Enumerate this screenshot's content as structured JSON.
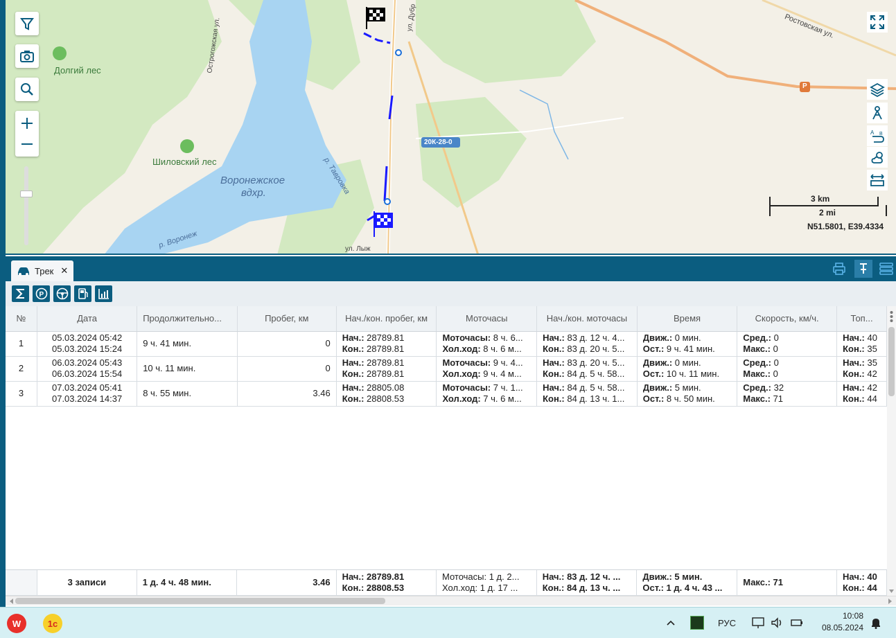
{
  "map": {
    "labels": {
      "dolgiy_les": "Долгий лес",
      "shilovskiy_les": "Шиловский лес",
      "reservoir_1": "Воронежское",
      "reservoir_2": "вдхр.",
      "river_tavrovka": "р. Тавровка",
      "river_voronezh": "р. Воронеж",
      "street_ostrogozhskaya": "Острогожская ул.",
      "street_dubr": "ул. Дубр",
      "street_rostovskaya": "Ростовская ул.",
      "street_lyzh": "ул. Лыж",
      "road_badge": "20К-28-0",
      "road_badge_small": "Р"
    },
    "scale_km": "3 km",
    "scale_mi": "2 mi",
    "coordinates": "N51.5801, E39.4334",
    "icons": {
      "filter": "filter-icon",
      "camera": "camera-icon",
      "search": "search-icon",
      "zoom_in": "plus-icon",
      "zoom_out": "minus-icon",
      "fullscreen": "fullscreen-icon",
      "layers": "layers-icon",
      "routing": "route-icon",
      "translate": "directions-icon",
      "weather": "weather-icon",
      "ruler": "ruler-icon"
    },
    "zoom_level": 0.65
  },
  "panel": {
    "tab_label": "Трек",
    "tab_close": "✕",
    "toolbar": [
      "sum-icon",
      "parking-icon",
      "steering-wheel-icon",
      "fuel-icon",
      "chart-icon"
    ]
  },
  "table": {
    "columns": [
      "№",
      "Дата",
      "Продолжительно...",
      "Пробег, км",
      "Нач./кон. пробег, км",
      "Моточасы",
      "Нач./кон. моточасы",
      "Время",
      "Скорость, км/ч.",
      "Топ..."
    ],
    "rows": [
      {
        "num": "1",
        "date_start": "05.03.2024 05:42",
        "date_end": "05.03.2024 15:24",
        "duration": "9 ч. 41 мин.",
        "mileage": "0",
        "odo_start_label": "Нач.:",
        "odo_start": " 28789.81",
        "odo_end_label": "Кон.:",
        "odo_end": " 28789.81",
        "moto_label": "Моточасы:",
        "moto": " 8 ч. 6...",
        "idle_label": "Хол.ход:",
        "idle": " 8 ч. 6 м...",
        "mh_start_label": "Нач.:",
        "mh_start": " 83 д. 12 ч. 4...",
        "mh_end_label": "Кон.:",
        "mh_end": " 83 д. 20 ч. 5...",
        "move_label": "Движ.:",
        "move": " 0 мин.",
        "stop_label": "Ост.:",
        "stop": " 9 ч. 41 мин.",
        "avg_label": "Сред.:",
        "avg": " 0",
        "max_label": "Макс.:",
        "max": " 0",
        "fuel_start_label": "Нач.:",
        "fuel_start": " 40",
        "fuel_end_label": "Кон.:",
        "fuel_end": " 35"
      },
      {
        "num": "2",
        "date_start": "06.03.2024 05:43",
        "date_end": "06.03.2024 15:54",
        "duration": "10 ч. 11 мин.",
        "mileage": "0",
        "odo_start_label": "Нач.:",
        "odo_start": " 28789.81",
        "odo_end_label": "Кон.:",
        "odo_end": " 28789.81",
        "moto_label": "Моточасы:",
        "moto": " 9 ч. 4...",
        "idle_label": "Хол.ход:",
        "idle": " 9 ч. 4 м...",
        "mh_start_label": "Нач.:",
        "mh_start": " 83 д. 20 ч. 5...",
        "mh_end_label": "Кон.:",
        "mh_end": " 84 д. 5 ч. 58...",
        "move_label": "Движ.:",
        "move": " 0 мин.",
        "stop_label": "Ост.:",
        "stop": " 10 ч. 11 мин.",
        "avg_label": "Сред.:",
        "avg": " 0",
        "max_label": "Макс.:",
        "max": " 0",
        "fuel_start_label": "Нач.:",
        "fuel_start": " 35",
        "fuel_end_label": "Кон.:",
        "fuel_end": " 42"
      },
      {
        "num": "3",
        "date_start": "07.03.2024 05:41",
        "date_end": "07.03.2024 14:37",
        "duration": "8 ч. 55 мин.",
        "mileage": "3.46",
        "odo_start_label": "Нач.:",
        "odo_start": " 28805.08",
        "odo_end_label": "Кон.:",
        "odo_end": " 28808.53",
        "moto_label": "Моточасы:",
        "moto": " 7 ч. 1...",
        "idle_label": "Хол.ход:",
        "idle": " 7 ч. 6 м...",
        "mh_start_label": "Нач.:",
        "mh_start": " 84 д. 5 ч. 58...",
        "mh_end_label": "Кон.:",
        "mh_end": " 84 д. 13 ч. 1...",
        "move_label": "Движ.:",
        "move": " 5 мин.",
        "stop_label": "Ост.:",
        "stop": " 8 ч. 50 мин.",
        "avg_label": "Сред.:",
        "avg": " 32",
        "max_label": "Макс.:",
        "max": " 71",
        "fuel_start_label": "Нач.:",
        "fuel_start": " 42",
        "fuel_end_label": "Кон.:",
        "fuel_end": " 44"
      }
    ],
    "footer": {
      "count": "3 записи",
      "duration": "1 д. 4 ч. 48 мин.",
      "mileage": "3.46",
      "odo_start": "Нач.: 28789.81",
      "odo_end": "Кон.: 28808.53",
      "moto": "Моточасы: 1 д. 2...",
      "idle": "Хол.ход: 1 д. 17 ...",
      "mh_start": "Нач.: 83 д. 12 ч. ...",
      "mh_end": "Кон.: 84 д. 13 ч. ...",
      "move": "Движ.: 5 мин.",
      "stop": "Ост.: 1 д. 4 ч. 43 ...",
      "speed": "Макс.: 71",
      "fuel_start": "Нач.: 40",
      "fuel_end": "Кон.: 44"
    }
  },
  "taskbar": {
    "lang": "РУС",
    "time": "10:08",
    "date": "08.05.2024",
    "apps": [
      "wps-office-icon",
      "1c-icon"
    ]
  },
  "colors": {
    "header": "#0b5d80",
    "track": "#1a1aff",
    "water": "#a8d4f2",
    "forest": "#cbe6b6"
  }
}
